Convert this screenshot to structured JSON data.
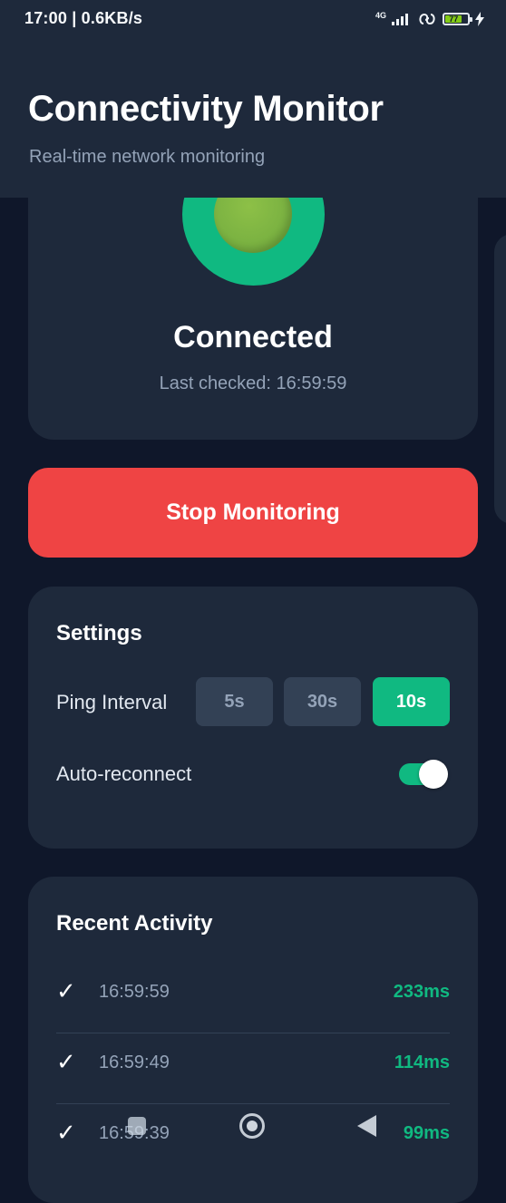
{
  "status_bar": {
    "time": "17:00 | 0.6KB/s",
    "network": "4G",
    "battery": "77"
  },
  "header": {
    "title": "Connectivity Monitor",
    "subtitle": "Real-time network monitoring"
  },
  "status": {
    "state": "Connected",
    "last_checked": "Last checked: 16:59:59",
    "indicator_color": "#7cb342",
    "ring_color": "#10b981"
  },
  "actions": {
    "stop_label": "Stop Monitoring"
  },
  "settings": {
    "title": "Settings",
    "ping_label": "Ping Interval",
    "intervals": [
      "5s",
      "30s",
      "10s"
    ],
    "selected_interval": "10s",
    "auto_reconnect_label": "Auto-reconnect",
    "auto_reconnect": true
  },
  "activity": {
    "title": "Recent Activity",
    "items": [
      {
        "status": "✓",
        "time": "16:59:59",
        "latency": "233ms"
      },
      {
        "status": "✓",
        "time": "16:59:49",
        "latency": "114ms"
      },
      {
        "status": "✓",
        "time": "16:59:39",
        "latency": "99ms"
      }
    ]
  },
  "colors": {
    "background": "#0f172a",
    "card": "#1e293b",
    "accent": "#10b981",
    "danger": "#ef4444"
  },
  "nav_icons": [
    "recents-icon",
    "home-icon",
    "back-icon"
  ]
}
